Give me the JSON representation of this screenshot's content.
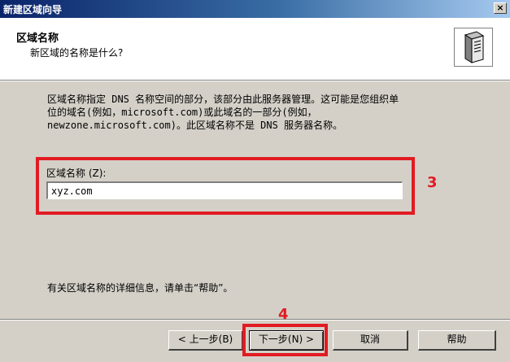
{
  "window": {
    "title": "新建区域向导",
    "close_label": "×"
  },
  "header": {
    "title": "区域名称",
    "subtitle": "新区域的名称是什么?",
    "icon": "server-icon"
  },
  "body": {
    "description": "区域名称指定 DNS 名称空间的部分，该部分由此服务器管理。这可能是您组织单\n位的域名(例如，microsoft.com)或此域名的一部分(例如，\nnewzone.microsoft.com)。此区域名称不是 DNS 服务器名称。",
    "field_label": "区域名称 (Z):",
    "field_value": "xyz.com",
    "help_info": "有关区域名称的详细信息，请单击“帮助”。"
  },
  "annotations": {
    "step3": "3",
    "step4": "4",
    "highlight_color": "#e21b22"
  },
  "buttons": {
    "back": "< 上一步(B)",
    "next": "下一步(N) >",
    "cancel": "取消",
    "help": "帮助"
  }
}
